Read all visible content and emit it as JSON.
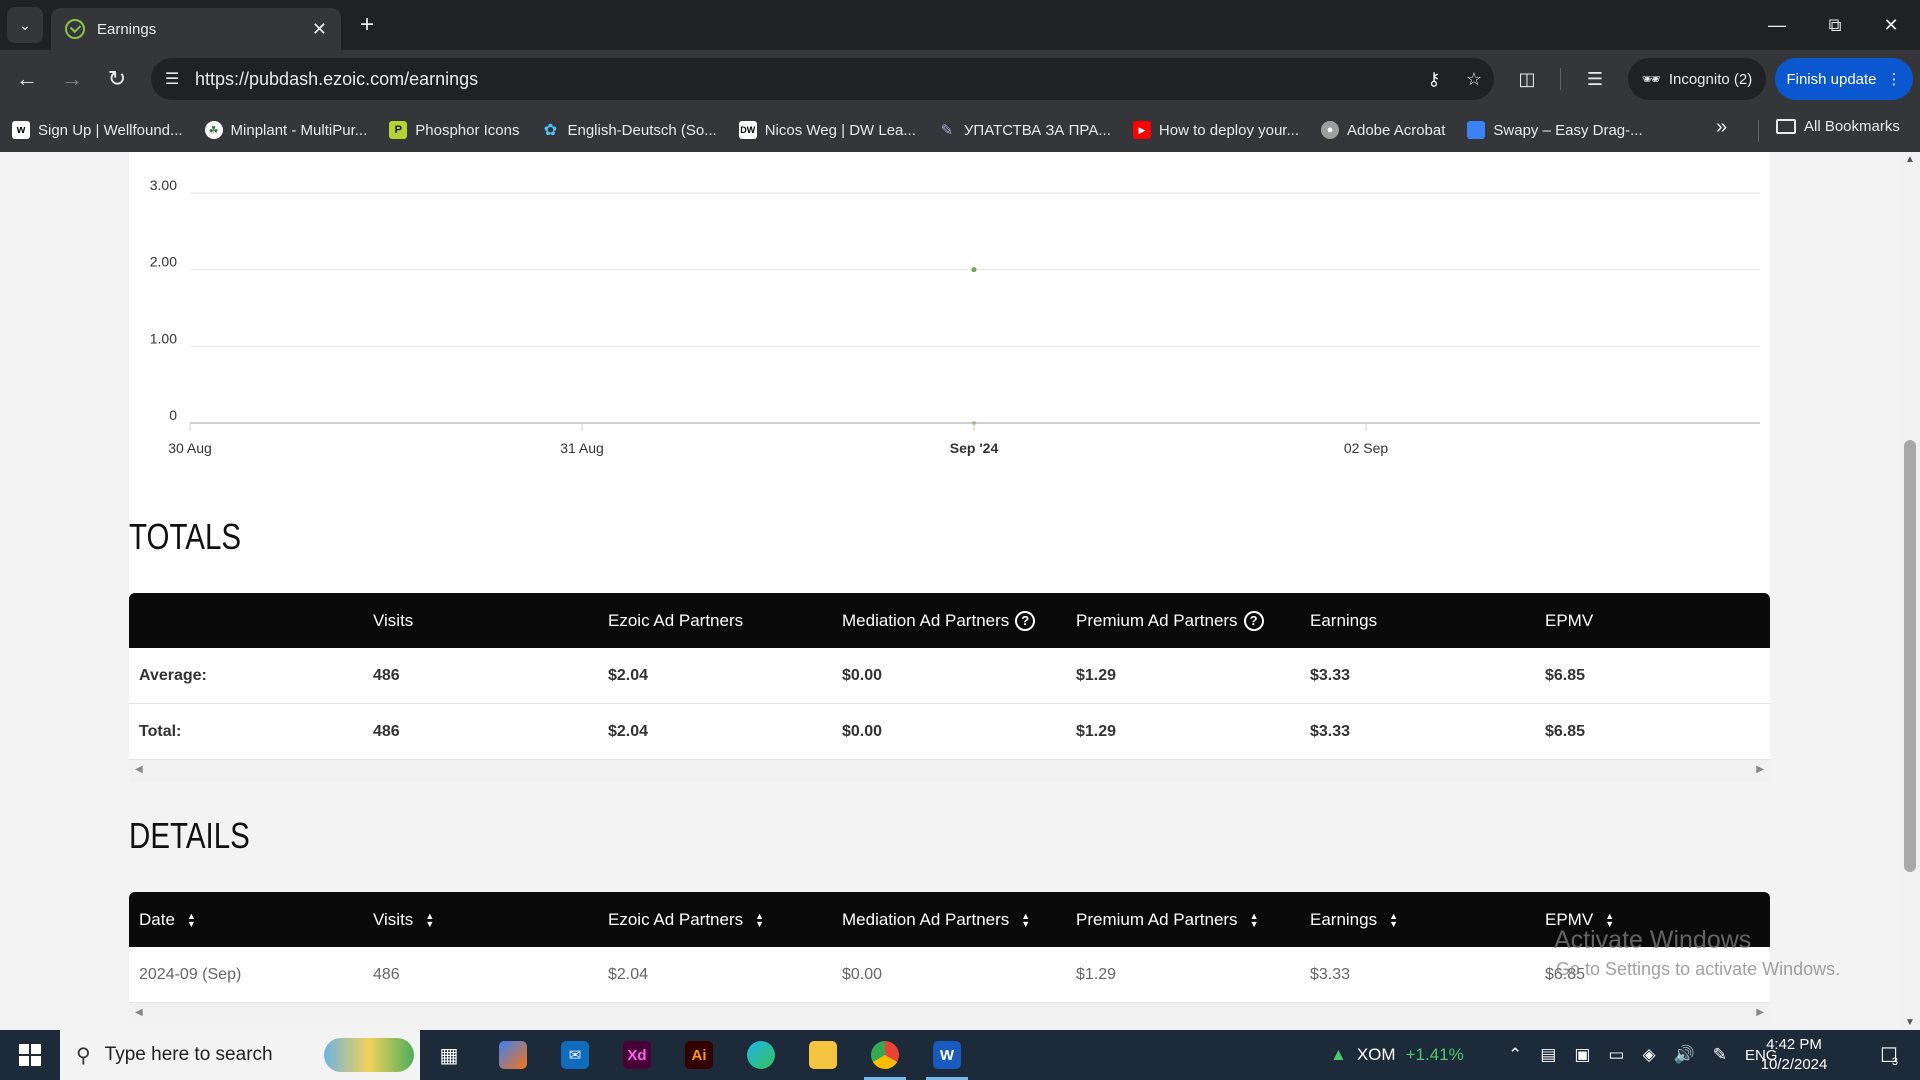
{
  "browser": {
    "tab_title": "Earnings",
    "url": "https://pubdash.ezoic.com/earnings",
    "incognito_label": "Incognito (2)",
    "update_label": "Finish update",
    "bookmarks": [
      {
        "label": "Sign Up | Wellfound...",
        "icon": "wellfound-icon",
        "color": "#ffffff"
      },
      {
        "label": "Minplant - MultiPur...",
        "icon": "leaf-icon",
        "color": "#ffffff"
      },
      {
        "label": "Phosphor Icons",
        "icon": "phosphor-icon",
        "color": "#b5d334"
      },
      {
        "label": "English-Deutsch (So...",
        "icon": "puzzle-icon",
        "color": "#4fc3f7"
      },
      {
        "label": "Nicos Weg | DW Lea...",
        "icon": "dw-icon",
        "color": "#ffffff"
      },
      {
        "label": "УПАТСТВА ЗА ПРА...",
        "icon": "pen-icon",
        "color": "#9fa8da"
      },
      {
        "label": "How to deploy your...",
        "icon": "youtube-icon",
        "color": "#ff0000"
      },
      {
        "label": "Adobe Acrobat",
        "icon": "globe-icon",
        "color": "#9e9e9e"
      },
      {
        "label": "Swapy – Easy Drag-...",
        "icon": "swapy-icon",
        "color": "#3b82f6"
      }
    ],
    "all_bookmarks": "All Bookmarks"
  },
  "chart_data": {
    "type": "line",
    "x_ticks": [
      "30 Aug",
      "31 Aug",
      "Sep '24",
      "02 Sep"
    ],
    "x_tick_emphasis": "Sep '24",
    "y_ticks": [
      "0",
      "1.00",
      "2.00",
      "3.00"
    ],
    "ylim": [
      0,
      3
    ],
    "series": [
      {
        "color": "#6aa84f",
        "points": [
          {
            "x": "Sep '24",
            "y": 2.0
          },
          {
            "x": "Sep '24",
            "y": 0
          }
        ]
      }
    ],
    "grid": true
  },
  "totals": {
    "title": "TOTALS",
    "columns": [
      "Visits",
      "Ezoic Ad Partners",
      "Mediation Ad Partners",
      "Premium Ad Partners",
      "Earnings",
      "EPMV"
    ],
    "rows": [
      {
        "label": "Average:",
        "values": [
          "486",
          "$2.04",
          "$0.00",
          "$1.29",
          "$3.33",
          "$6.85"
        ]
      },
      {
        "label": "Total:",
        "values": [
          "486",
          "$2.04",
          "$0.00",
          "$1.29",
          "$3.33",
          "$6.85"
        ]
      }
    ]
  },
  "details": {
    "title": "DETAILS",
    "columns": [
      "Date",
      "Visits",
      "Ezoic Ad Partners",
      "Mediation Ad Partners",
      "Premium Ad Partners",
      "Earnings",
      "EPMV"
    ],
    "rows": [
      {
        "values": [
          "2024-09 (Sep)",
          "486",
          "$2.04",
          "$0.00",
          "$1.29",
          "$3.33",
          "$6.85"
        ]
      }
    ]
  },
  "watermark": {
    "line1": "Activate Windows",
    "line2": "Go to Settings to activate Windows."
  },
  "taskbar": {
    "search_placeholder": "Type here to search",
    "stock_symbol": "XOM",
    "stock_change": "+1.41%",
    "language": "ENG",
    "time": "4:42 PM",
    "date": "10/2/2024",
    "notification_count": "3"
  }
}
